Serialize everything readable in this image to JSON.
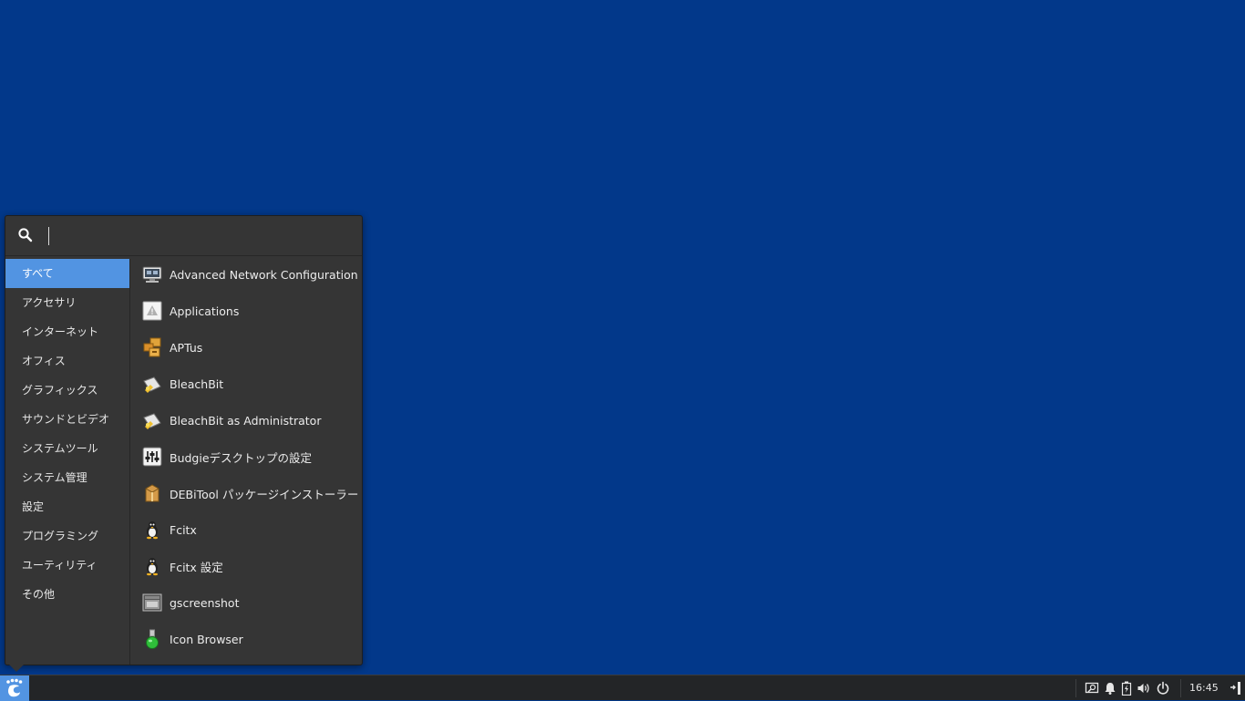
{
  "desktop": {
    "background": "#02388a"
  },
  "menu": {
    "search": {
      "value": "",
      "placeholder": ""
    },
    "categories": [
      {
        "label": "すべて",
        "active": true
      },
      {
        "label": "アクセサリ"
      },
      {
        "label": "インターネット"
      },
      {
        "label": "オフィス"
      },
      {
        "label": "グラフィックス"
      },
      {
        "label": "サウンドとビデオ"
      },
      {
        "label": "システムツール"
      },
      {
        "label": "システム管理"
      },
      {
        "label": "設定"
      },
      {
        "label": "プログラミング"
      },
      {
        "label": "ユーティリティ"
      },
      {
        "label": "その他"
      }
    ],
    "apps": [
      {
        "label": "Advanced Network Configuration",
        "icon": "network-config-icon"
      },
      {
        "label": "Applications",
        "icon": "applications-icon"
      },
      {
        "label": "APTus",
        "icon": "aptus-icon"
      },
      {
        "label": "BleachBit",
        "icon": "bleachbit-icon"
      },
      {
        "label": "BleachBit as Administrator",
        "icon": "bleachbit-icon"
      },
      {
        "label": "Budgieデスクトップの設定",
        "icon": "budgie-settings-icon"
      },
      {
        "label": "DEBiTool パッケージインストーラー",
        "icon": "debitool-package-icon"
      },
      {
        "label": "Fcitx",
        "icon": "fcitx-penguin-icon"
      },
      {
        "label": "Fcitx 設定",
        "icon": "fcitx-penguin-icon"
      },
      {
        "label": "gscreenshot",
        "icon": "gscreenshot-icon"
      },
      {
        "label": "Icon Browser",
        "icon": "icon-browser-flask-icon"
      }
    ]
  },
  "panel": {
    "clock": "16:45",
    "accent": "#5294e2",
    "tray_icons": [
      "screenshot-icon",
      "notification-bell-icon",
      "battery-icon",
      "volume-icon",
      "power-icon",
      "show-desktop-icon"
    ]
  }
}
